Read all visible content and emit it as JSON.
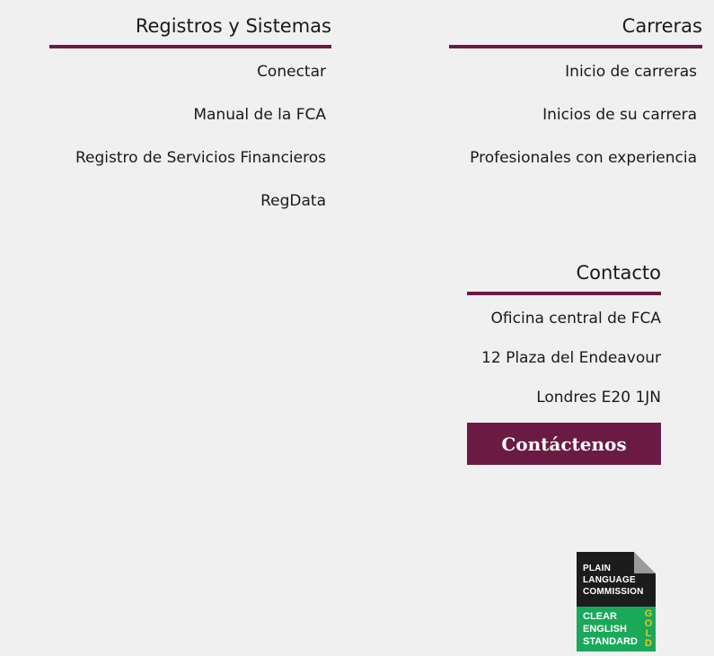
{
  "registros": {
    "heading": "Registros y Sistemas",
    "links": [
      {
        "label": "Conectar"
      },
      {
        "label": "Manual de la FCA"
      },
      {
        "label": "Registro de Servicios Financieros"
      },
      {
        "label": "RegData"
      }
    ]
  },
  "carreras": {
    "heading": "Carreras",
    "links": [
      {
        "label": "Inicio de carreras"
      },
      {
        "label": "Inicios de su carrera"
      },
      {
        "label": "Profesionales con experiencia"
      }
    ]
  },
  "contacto": {
    "heading": "Contacto",
    "address": [
      "Oficina central de FCA",
      "12 Plaza del Endeavour",
      "Londres E20 1JN"
    ],
    "button_label": "Contáctenos"
  },
  "badge": {
    "line1": "PLAIN",
    "line2": "LANGUAGE",
    "line3": "COMMISSION",
    "line4": "CLEAR",
    "line5": "ENGLISH",
    "line6": "STANDARD",
    "gold": "GOLD"
  },
  "colors": {
    "accent": "#6b1a44",
    "background": "#f0f0f0",
    "badge_green": "#1aa85a",
    "badge_gold": "#f2c21b"
  }
}
